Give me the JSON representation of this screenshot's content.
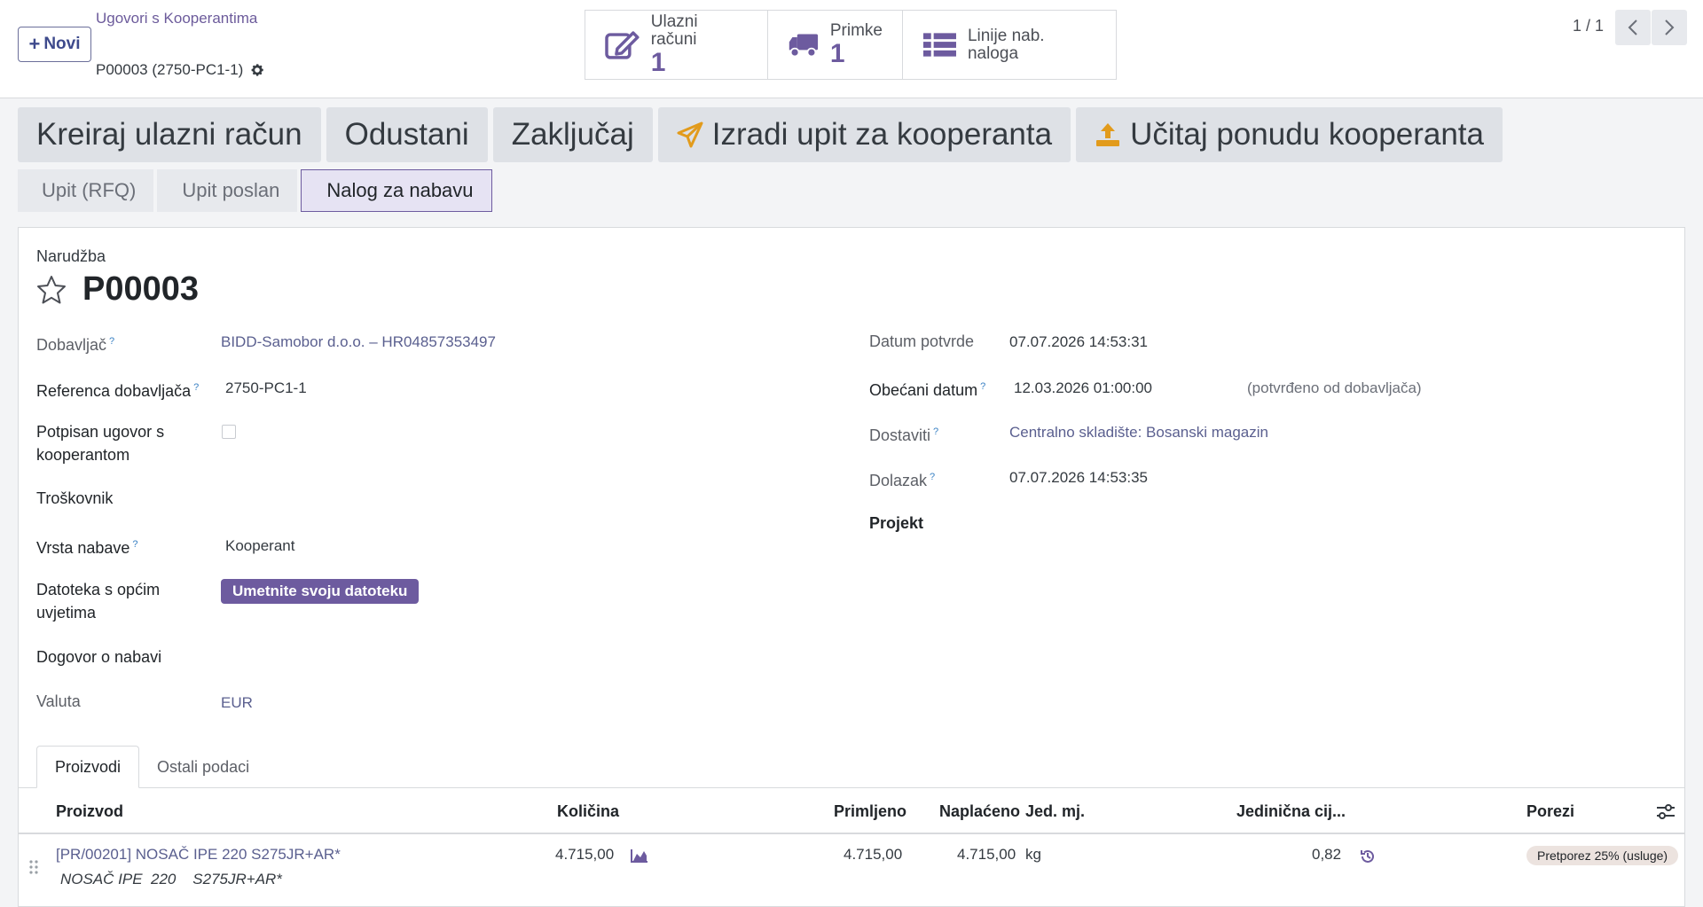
{
  "control_panel": {
    "new_button": "Novi",
    "breadcrumb_parent": "Ugovori s Kooperantima",
    "record_name": "P00003 (2750-PC1-1)",
    "pager": "1 / 1",
    "smart_buttons": [
      {
        "label": "Ulazni računi",
        "value": "1",
        "icon": "pencil-square-icon"
      },
      {
        "label": "Primke",
        "value": "1",
        "icon": "truck-icon"
      },
      {
        "label": "Linije nab. naloga",
        "value": "",
        "icon": "list-icon"
      }
    ]
  },
  "actions": {
    "create_bill": "Kreiraj ulazni račun",
    "cancel": "Odustani",
    "lock": "Zaključaj",
    "send_rfq": "Izradi upit za kooperanta",
    "upload_offer": "Učitaj ponudu kooperanta"
  },
  "statusbar": {
    "stages": [
      "Upit (RFQ)",
      "Upit poslan",
      "Nalog za nabavu"
    ],
    "active": "Nalog za nabavu"
  },
  "form": {
    "order_label": "Narudžba",
    "order_name": "P00003",
    "left": {
      "supplier_label": "Dobavljač",
      "supplier_value": "BIDD-Samobor d.o.o. – HR04857353497",
      "supplier_ref_label": "Referenca dobavljača",
      "supplier_ref_value": "2750-PC1-1",
      "signed_label_1": "Potpisan ugovor s",
      "signed_label_2": "kooperantom",
      "cost_label": "Troškovnik",
      "procurement_type_label": "Vrsta nabave",
      "procurement_type_value": "Kooperant",
      "terms_file_label_1": "Datoteka s općim",
      "terms_file_label_2": "uvjetima",
      "terms_file_button": "Umetnite svoju datoteku",
      "agreement_label": "Dogovor o nabavi",
      "currency_label": "Valuta",
      "currency_value": "EUR"
    },
    "right": {
      "confirm_date_label": "Datum potvrde",
      "confirm_date_value": "07.07.2026 14:53:31",
      "promised_date_label": "Obećani datum",
      "promised_date_value": "12.03.2026 01:00:00",
      "promised_date_note": "(potvrđeno od dobavljača)",
      "deliver_to_label": "Dostaviti",
      "deliver_to_value": "Centralno skladište: Bosanski magazin",
      "arrival_label": "Dolazak",
      "arrival_value": "07.07.2026 14:53:35",
      "project_label": "Projekt"
    }
  },
  "tabs": [
    "Proizvodi",
    "Ostali podaci"
  ],
  "table": {
    "columns": [
      "Proizvod",
      "Količina",
      "Primljeno",
      "Naplaćeno",
      "Jed. mj.",
      "Jedinična cij...",
      "Porezi"
    ],
    "rows": [
      {
        "product": "[PR/00201] NOSAČ IPE 220 S275JR+AR*",
        "description": "NOSAČ IPE  220    S275JR+AR*",
        "quantity": "4.715,00",
        "received": "4.715,00",
        "invoiced": "4.715,00",
        "uom": "kg",
        "unit_price": "0,82",
        "tax": "Pretporez 25% (usluge)"
      }
    ]
  },
  "colors": {
    "accent": "#6d5b9f",
    "warning_icon": "#e29b1c"
  }
}
